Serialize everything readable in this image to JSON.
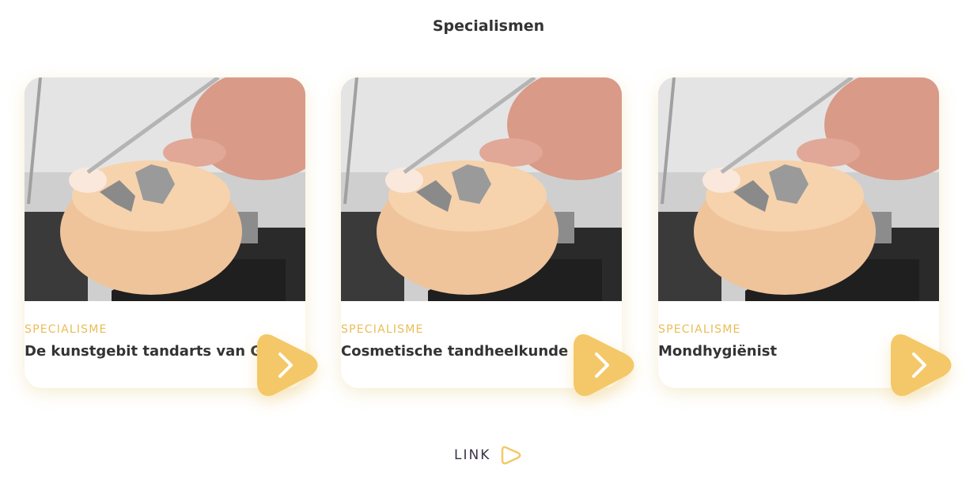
{
  "section": {
    "title": "Specialismen"
  },
  "cards": [
    {
      "label": "SPECIALISME",
      "heading": "De kunstgebit tandarts van G",
      "image": "dental-prosthesis-photo",
      "arrow_icon": "chevron-right-icon"
    },
    {
      "label": "SPECIALISME",
      "heading": "Cosmetische tandheelkunde",
      "image": "dental-prosthesis-photo",
      "arrow_icon": "chevron-right-icon"
    },
    {
      "label": "SPECIALISME",
      "heading": "Mondhygiënist",
      "image": "dental-prosthesis-photo",
      "arrow_icon": "chevron-right-icon"
    }
  ],
  "footer": {
    "link_label": "LINK",
    "link_icon": "play-outline-icon"
  },
  "colors": {
    "accent": "#f4c868",
    "label": "#e9bd57",
    "heading": "#333333"
  }
}
